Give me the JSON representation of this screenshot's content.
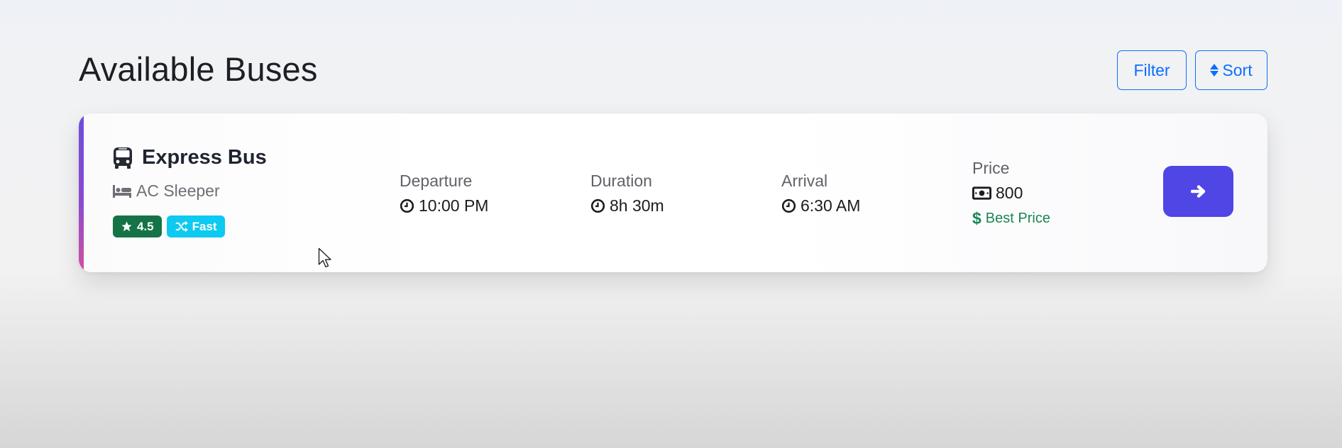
{
  "header": {
    "title": "Available Buses",
    "filter_label": "Filter",
    "sort_label": "Sort"
  },
  "bus": {
    "name": "Express Bus",
    "type": "AC Sleeper",
    "rating": "4.5",
    "speed_tag": "Fast",
    "departure_label": "Departure",
    "departure_time": "10:00 PM",
    "duration_label": "Duration",
    "duration": "8h 30m",
    "arrival_label": "Arrival",
    "arrival_time": "6:30 AM",
    "price_label": "Price",
    "price": "800",
    "price_tag": "Best Price"
  },
  "icons": {
    "bus": "bus-icon",
    "bed": "bed-icon",
    "star": "star-icon",
    "shuffle": "shuffle-icon",
    "clock": "clock-icon",
    "money": "money-bill-icon",
    "dollar": "dollar-icon",
    "arrow": "arrow-right-icon",
    "sort": "sort-icon"
  },
  "colors": {
    "primary": "#0d6efd",
    "go_button": "#4f46e5",
    "rating_badge": "#157347",
    "fast_badge": "#0dcaf0",
    "best_price": "#198754",
    "accent_top": "#6b4fd8",
    "accent_bottom": "#d24fa0"
  }
}
